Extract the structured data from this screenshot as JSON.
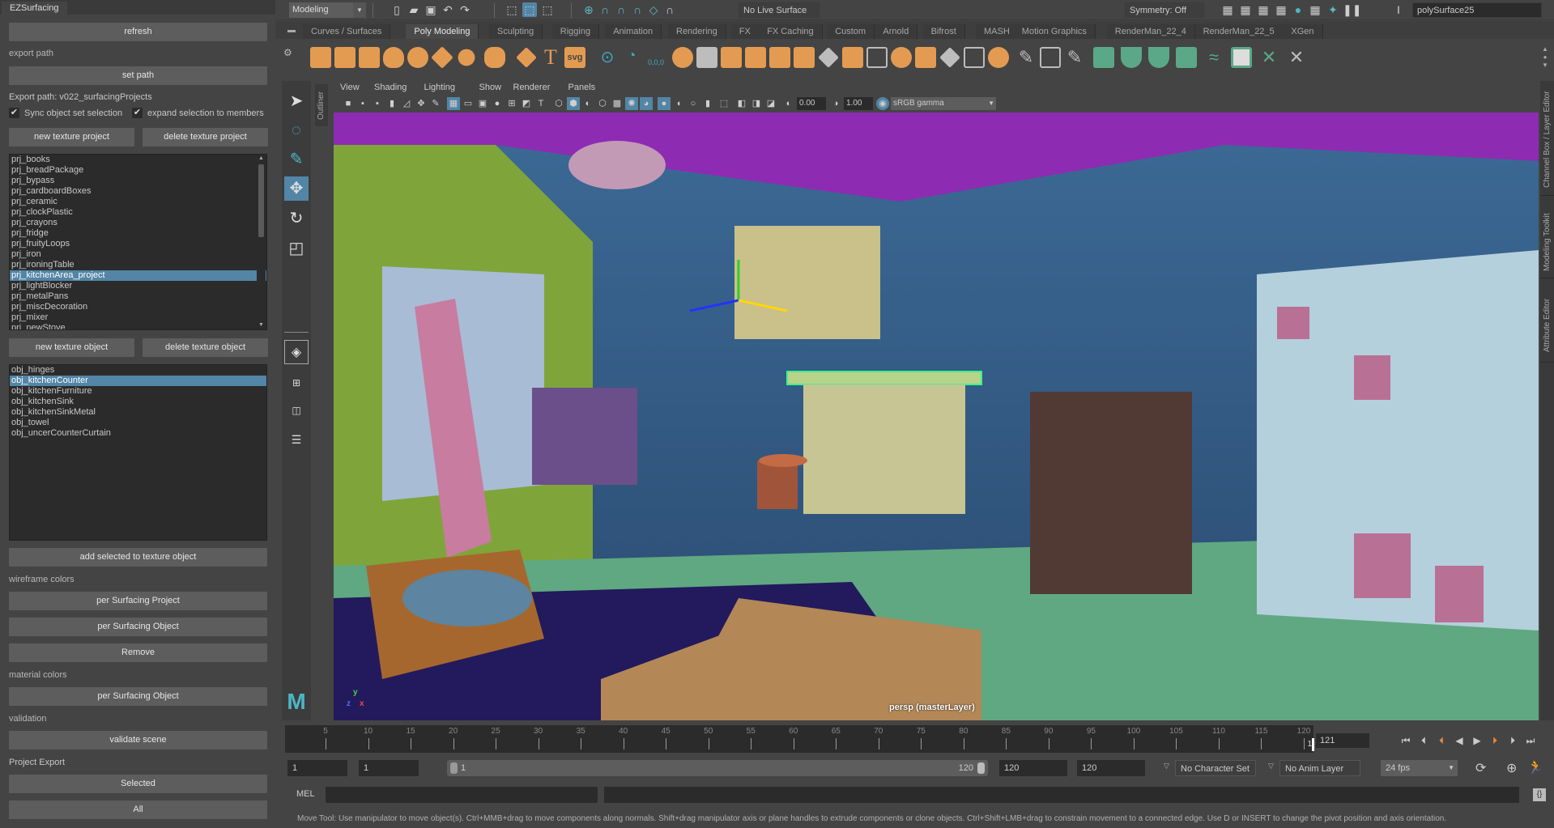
{
  "left_panel": {
    "tab_title": "EZSurfacing",
    "refresh_label": "refresh",
    "export_path_label": "export path",
    "set_path_label": "set path",
    "export_path_value": "Export path: v022_surfacingProjects",
    "sync_checkbox": {
      "label": "Sync object set selection",
      "checked": true
    },
    "expand_checkbox": {
      "label": "expand selection to members",
      "checked": true
    },
    "new_project_label": "new texture project",
    "delete_project_label": "delete texture project",
    "projects": [
      "prj_books",
      "prj_breadPackage",
      "prj_bypass",
      "prj_cardboardBoxes",
      "prj_ceramic",
      "prj_clockPlastic",
      "prj_crayons",
      "prj_fridge",
      "prj_fruityLoops",
      "prj_iron",
      "prj_ironingTable",
      "prj_kitchenArea_project",
      "prj_lightBlocker",
      "prj_metalPans",
      "prj_miscDecoration",
      "prj_mixer",
      "prj_newStove"
    ],
    "selected_project": "prj_kitchenArea_project",
    "new_object_label": "new texture object",
    "delete_object_label": "delete texture object",
    "objects": [
      "obj_hinges",
      "obj_kitchenCounter",
      "obj_kitchenFurniture",
      "obj_kitchenSink",
      "obj_kitchenSinkMetal",
      "obj_towel",
      "obj_uncerCounterCurtain"
    ],
    "selected_object": "obj_kitchenCounter",
    "add_selected_label": "add selected to texture object",
    "wireframe_colors_label": "wireframe colors",
    "per_project_label": "per Surfacing Project",
    "per_object_label": "per Surfacing Object",
    "remove_label": "Remove",
    "material_colors_label": "material colors",
    "material_per_object_label": "per Surfacing Object",
    "validation_label": "validation",
    "validate_label": "validate scene",
    "project_export_label": "Project Export",
    "export_selected_label": "Selected",
    "export_all_label": "All"
  },
  "status_line": {
    "menu_set": "Modeling",
    "live_surface": "No Live Surface",
    "symmetry": "Symmetry: Off",
    "selection_field": "polySurface25"
  },
  "shelf_tabs": [
    "Curves / Surfaces",
    "Poly Modeling",
    "Sculpting",
    "Rigging",
    "Animation",
    "Rendering",
    "FX",
    "FX Caching",
    "Custom",
    "Arnold",
    "Bifrost",
    "MASH",
    "Motion Graphics",
    "RenderMan_22_4",
    "RenderMan_22_5",
    "XGen"
  ],
  "active_shelf_tab": "Poly Modeling",
  "shelf_svg_label": "svg",
  "shelf_coord_label": "0,0,0",
  "panel_menu": [
    "View",
    "Shading",
    "Lighting",
    "Show",
    "Renderer",
    "Panels"
  ],
  "panel_toolbar": {
    "exposure": "0.00",
    "gamma": "1.00",
    "color_space": "sRGB gamma"
  },
  "outliner_tab": "Outliner",
  "right_tabs": [
    "Channel Box / Layer Editor",
    "Modeling Toolkit",
    "Attribute Editor"
  ],
  "viewport": {
    "camera_label": "persp (masterLayer)",
    "axis": {
      "x": "x",
      "y": "y",
      "z": "z"
    }
  },
  "timeline": {
    "ticks": [
      5,
      10,
      15,
      20,
      25,
      30,
      35,
      40,
      45,
      50,
      55,
      60,
      65,
      70,
      75,
      80,
      85,
      90,
      95,
      100,
      105,
      110,
      115,
      120
    ],
    "start": 1,
    "end": 120,
    "current_frame_marker": "1",
    "current_frame": "121"
  },
  "range": {
    "scene_start": "1",
    "playback_start": "1",
    "slider_start": "1",
    "slider_end": "120",
    "playback_end": "120",
    "scene_end": "120",
    "character_set": "No Character Set",
    "anim_layer": "No Anim Layer",
    "fps": "24 fps"
  },
  "command_line": {
    "language": "MEL",
    "input": "",
    "output": ""
  },
  "help_line": "Move Tool: Use manipulator to move object(s). Ctrl+MMB+drag to move components along normals. Shift+drag manipulator axis or plane handles to extrude components or clone objects. Ctrl+Shift+LMB+drag to constrain movement to a connected edge. Use D or INSERT to change the pivot position and axis orientation."
}
